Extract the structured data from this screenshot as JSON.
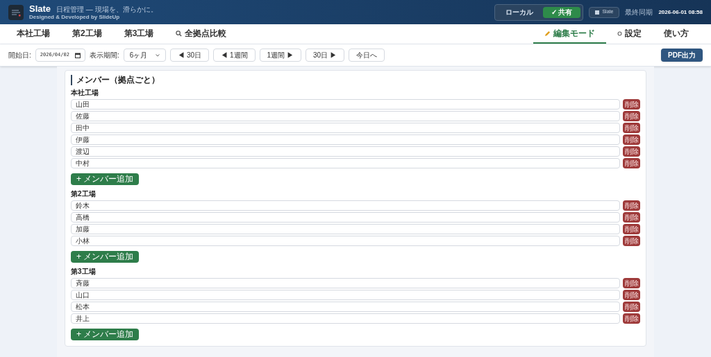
{
  "header": {
    "app_name": "Slate",
    "tagline": "日程管理 — 現場を、滑らかに。",
    "credit": "Designed & Developed by SlideUp",
    "mode_toggle": [
      {
        "label": "ローカル",
        "selected": false
      },
      {
        "label": "✓ 共有",
        "selected": true
      }
    ],
    "workspace_badge": "Slate",
    "last_sync_label": "最終同期",
    "last_sync": "2026-06-01 08:58"
  },
  "tabs_left": [
    {
      "label": "本社工場",
      "selected": false
    },
    {
      "label": "第2工場",
      "selected": false
    },
    {
      "label": "第3工場",
      "selected": false
    },
    {
      "label": "全拠点比較",
      "selected": false
    }
  ],
  "tabs_right": [
    {
      "label": "編集モード",
      "selected": true
    },
    {
      "label": "設定",
      "selected": false
    },
    {
      "label": "使い方",
      "selected": false
    }
  ],
  "toolbar": {
    "start_label": "開始日:",
    "start_date": "2026/04/02",
    "period_label": "表示期間:",
    "period": "6ヶ月",
    "nav_buttons": [
      "◀ 30日",
      "◀ 1週間",
      "1週間 ▶",
      "30日 ▶",
      "今日へ"
    ],
    "pdf_button": "PDF出力"
  },
  "section": {
    "title": "メンバー（拠点ごと）",
    "groups": [
      {
        "name": "本社工場",
        "members": [
          {
            "name": "山田",
            "delete_label": "削除"
          },
          {
            "name": "佐藤",
            "delete_label": "削除"
          },
          {
            "name": "田中",
            "delete_label": "削除"
          },
          {
            "name": "伊藤",
            "delete_label": "削除"
          },
          {
            "name": "渡辺",
            "delete_label": "削除"
          },
          {
            "name": "中村",
            "delete_label": "削除"
          }
        ],
        "add_button": "+ メンバー追加"
      },
      {
        "name": "第2工場",
        "members": [
          {
            "name": "鈴木",
            "delete_label": "削除"
          },
          {
            "name": "高橋",
            "delete_label": "削除"
          },
          {
            "name": "加藤",
            "delete_label": "削除"
          },
          {
            "name": "小林",
            "delete_label": "削除"
          }
        ],
        "add_button": "+ メンバー追加"
      },
      {
        "name": "第3工場",
        "members": [
          {
            "name": "斉藤",
            "delete_label": "削除"
          },
          {
            "name": "山口",
            "delete_label": "削除"
          },
          {
            "name": "松本",
            "delete_label": "削除"
          },
          {
            "name": "井上",
            "delete_label": "削除"
          }
        ],
        "add_button": "+ メンバー追加"
      }
    ]
  }
}
